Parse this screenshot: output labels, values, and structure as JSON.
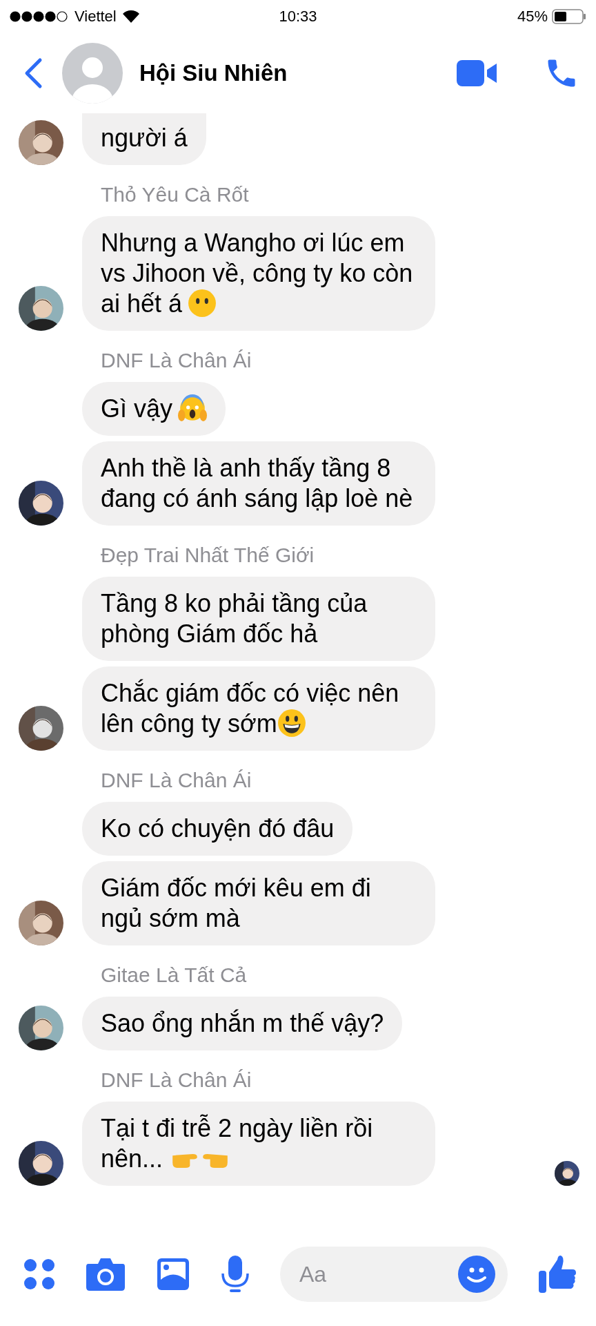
{
  "status_bar": {
    "carrier": "Viettel",
    "time": "10:33",
    "battery": "45%"
  },
  "header": {
    "title": "Hội Siu Nhiên"
  },
  "groups": [
    {
      "messages": [
        {
          "text": "người á",
          "kind": "plain"
        }
      ],
      "clipped": true,
      "seen": false
    },
    {
      "sender": "Thỏ Yêu Cà Rốt",
      "messages": [
        {
          "text": "Nhưng a Wangho ơi lúc em vs Jihoon về, công ty ko còn ai hết á",
          "kind": "neutral"
        }
      ],
      "clipped": false,
      "seen": false
    },
    {
      "sender": "DNF Là Chân Ái",
      "messages": [
        {
          "text": "Gì vậy",
          "kind": "scream"
        },
        {
          "text": "Anh thề là anh thấy tầng 8 đang có ánh sáng lập loè nè",
          "kind": "plain"
        }
      ],
      "clipped": false,
      "seen": false
    },
    {
      "sender": "Đẹp Trai Nhất Thế Giới",
      "messages": [
        {
          "text": "Tầng 8 ko phải tầng của phòng Giám đốc hả",
          "kind": "plain"
        },
        {
          "text": "Chắc giám đốc có việc nên lên công ty sớm",
          "kind": "grin"
        }
      ],
      "clipped": false,
      "seen": false
    },
    {
      "sender": "DNF Là Chân Ái",
      "messages": [
        {
          "text": "Ko có chuyện đó đâu",
          "kind": "plain"
        },
        {
          "text": "Giám đốc mới kêu em đi ngủ sớm mà",
          "kind": "plain"
        }
      ],
      "clipped": false,
      "seen": false
    },
    {
      "sender": "Gitae Là Tất Cả",
      "messages": [
        {
          "text": "Sao ổng nhắn m thế vậy?",
          "kind": "plain"
        }
      ],
      "clipped": false,
      "seen": false
    },
    {
      "sender": "DNF Là Chân Ái",
      "messages": [
        {
          "text": "Tại t đi trễ 2 ngày liền rồi nên...",
          "kind": "point"
        }
      ],
      "clipped": false,
      "seen": true
    }
  ],
  "composer": {
    "placeholder": "Aa"
  }
}
